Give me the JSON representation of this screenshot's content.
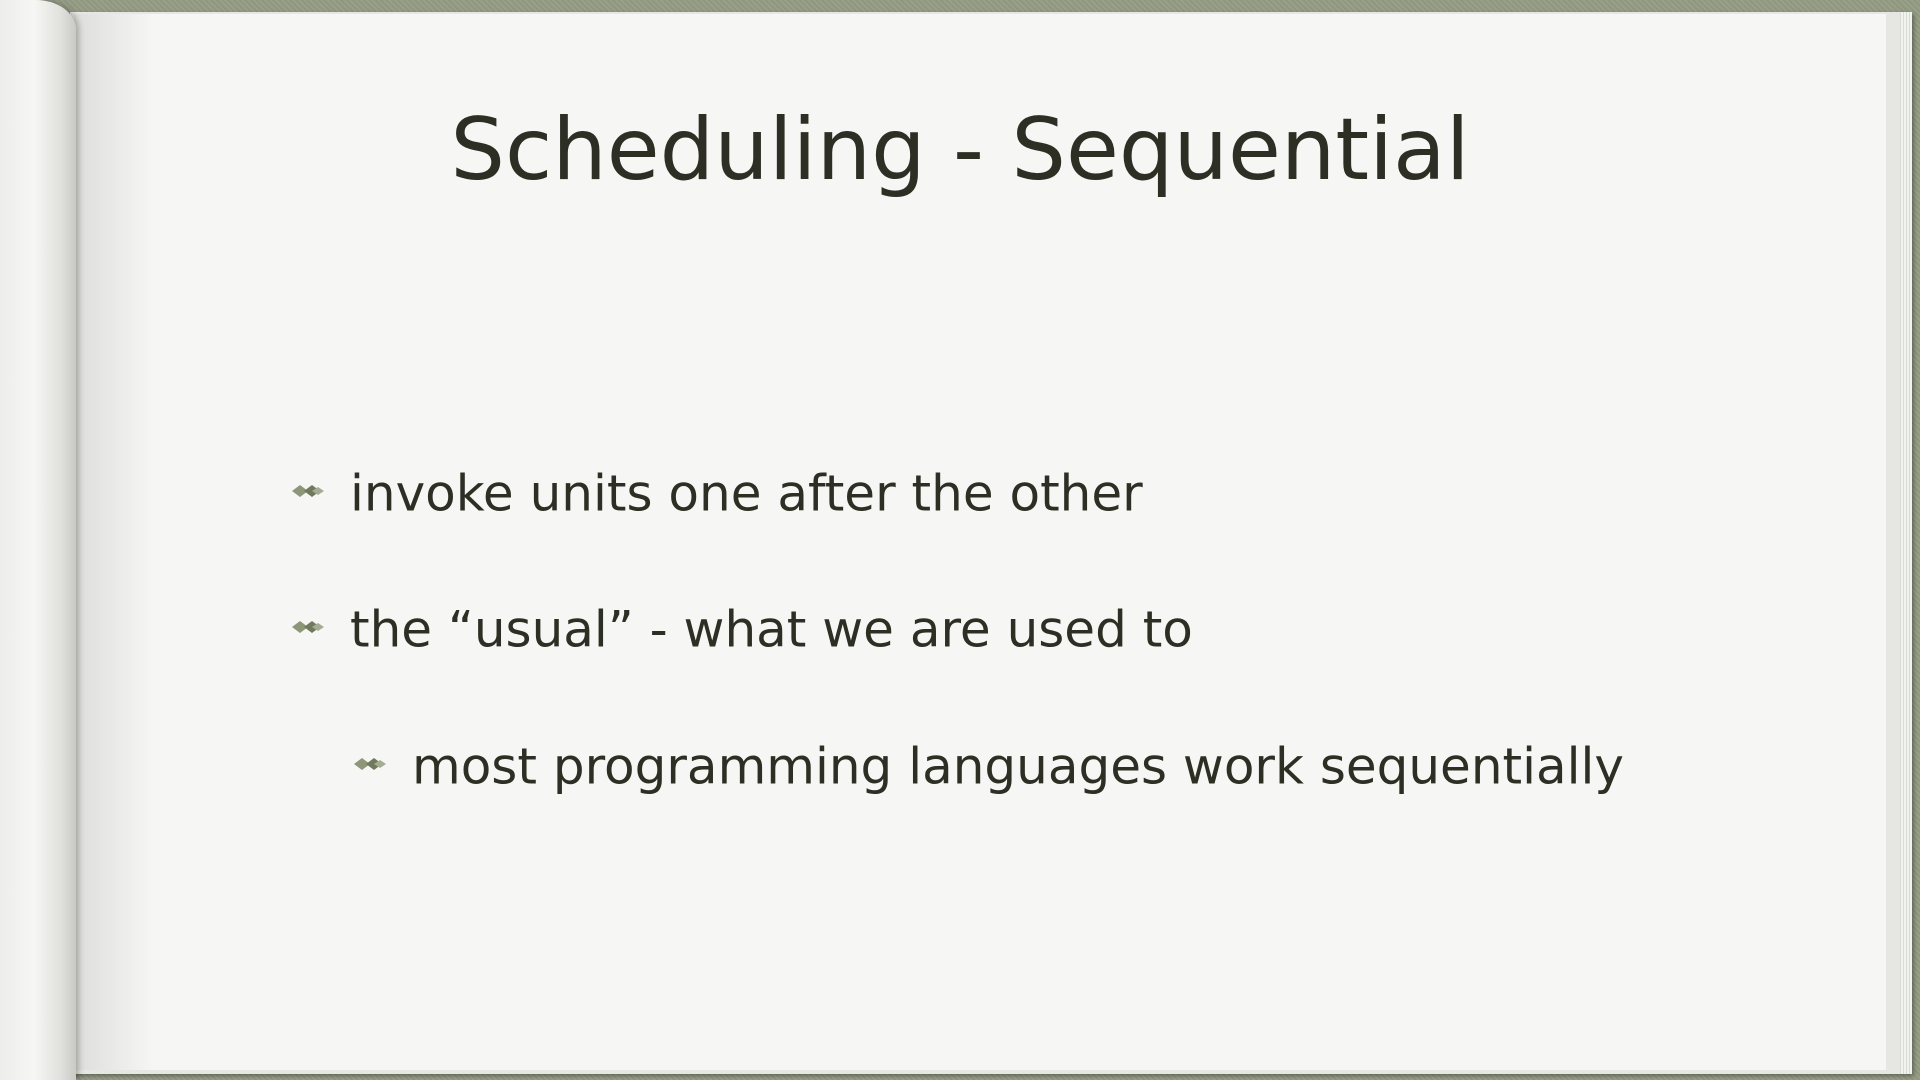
{
  "slide": {
    "title": "Scheduling - Sequential",
    "bullets": [
      {
        "text": "invoke units one after the other",
        "level": 1,
        "icon": "diamond-bullet-icon"
      },
      {
        "text": "the “usual” - what we are used to",
        "level": 1,
        "icon": "diamond-bullet-icon"
      },
      {
        "text": "most programming languages work sequentially",
        "level": 2,
        "icon": "diamond-bullet-icon"
      }
    ]
  },
  "colors": {
    "text": "#2e2f24",
    "bullet": "#6f7a5c",
    "page": "#f6f6f4",
    "frame": "#8e9680"
  }
}
